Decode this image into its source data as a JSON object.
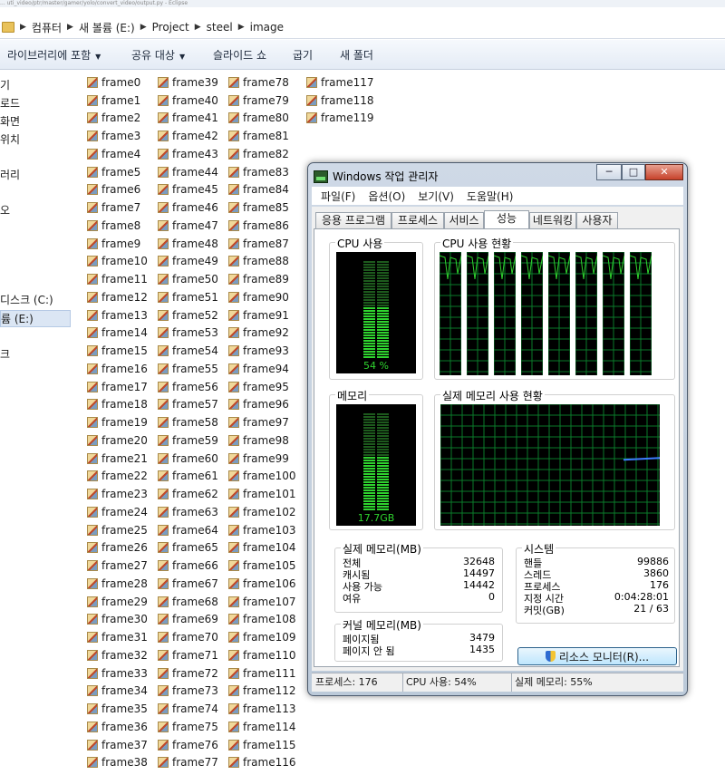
{
  "window_title_strip": "... uti_video/ptr/master/gamer/yolo/convert_video/output.py - Eclipse",
  "address_bar": {
    "segments": [
      "컴퓨터",
      "새 볼륨 (E:)",
      "Project",
      "steel",
      "image"
    ]
  },
  "toolbar": {
    "items": [
      "라이브러리에 포함",
      "공유 대상",
      "슬라이드 쇼",
      "굽기",
      "새 폴더"
    ]
  },
  "nav_pane": {
    "items": [
      "기",
      "로드",
      "화면",
      "위치",
      "러리",
      "오",
      "디스크 (C:)",
      "륨 (E:)",
      "크"
    ],
    "selected_index": 7
  },
  "files": {
    "column1": [
      "frame0",
      "frame1",
      "frame2",
      "frame3",
      "frame4",
      "frame5",
      "frame6",
      "frame7",
      "frame8",
      "frame9",
      "frame10",
      "frame11",
      "frame12",
      "frame13",
      "frame14",
      "frame15",
      "frame16",
      "frame17",
      "frame18",
      "frame19",
      "frame20",
      "frame21",
      "frame22",
      "frame23",
      "frame24",
      "frame25",
      "frame26",
      "frame27",
      "frame28",
      "frame29",
      "frame30",
      "frame31",
      "frame32",
      "frame33",
      "frame34",
      "frame35",
      "frame36",
      "frame37",
      "frame38"
    ],
    "column2": [
      "frame39",
      "frame40",
      "frame41",
      "frame42",
      "frame43",
      "frame44",
      "frame45",
      "frame46",
      "frame47",
      "frame48",
      "frame49",
      "frame50",
      "frame51",
      "frame52",
      "frame53",
      "frame54",
      "frame55",
      "frame56",
      "frame57",
      "frame58",
      "frame59",
      "frame60",
      "frame61",
      "frame62",
      "frame63",
      "frame64",
      "frame65",
      "frame66",
      "frame67",
      "frame68",
      "frame69",
      "frame70",
      "frame71",
      "frame72",
      "frame73",
      "frame74",
      "frame75",
      "frame76",
      "frame77"
    ],
    "column3": [
      "frame78",
      "frame79",
      "frame80",
      "frame81",
      "frame82",
      "frame83",
      "frame84",
      "frame85",
      "frame86",
      "frame87",
      "frame88",
      "frame89",
      "frame90",
      "frame91",
      "frame92",
      "frame93",
      "frame94",
      "frame95",
      "frame96",
      "frame97",
      "frame98",
      "frame99",
      "frame100",
      "frame101",
      "frame102",
      "frame103",
      "frame104",
      "frame105",
      "frame106",
      "frame107",
      "frame108",
      "frame109",
      "frame110",
      "frame111",
      "frame112",
      "frame113",
      "frame114",
      "frame115",
      "frame116"
    ],
    "column4": [
      "frame117",
      "frame118",
      "frame119"
    ]
  },
  "task_manager": {
    "title": "Windows 작업 관리자",
    "window_buttons": {
      "minimize": "─",
      "maximize": "□",
      "close": "✕"
    },
    "menu": [
      "파일(F)",
      "옵션(O)",
      "보기(V)",
      "도움말(H)"
    ],
    "tabs": [
      "응용 프로그램",
      "프로세스",
      "서비스",
      "성능",
      "네트워킹",
      "사용자"
    ],
    "active_tab_index": 3,
    "cpu_usage": {
      "label": "CPU 사용",
      "value_text": "54 %",
      "fraction": 0.54
    },
    "cpu_history": {
      "label": "CPU 사용 현황",
      "core_count": 8
    },
    "memory": {
      "label": "메모리",
      "value_text": "17.7GB",
      "fraction": 0.55
    },
    "memory_history": {
      "label": "실제 메모리 사용 현황"
    },
    "physical_memory": {
      "label": "실제 메모리(MB)",
      "rows": [
        {
          "k": "전체",
          "v": "32648"
        },
        {
          "k": "캐시됨",
          "v": "14497"
        },
        {
          "k": "사용 가능",
          "v": "14442"
        },
        {
          "k": "여유",
          "v": "0"
        }
      ]
    },
    "system": {
      "label": "시스템",
      "rows": [
        {
          "k": "핸들",
          "v": "99886"
        },
        {
          "k": "스레드",
          "v": "3860"
        },
        {
          "k": "프로세스",
          "v": "176"
        },
        {
          "k": "지정 시간",
          "v": "0:04:28:01"
        },
        {
          "k": "커밋(GB)",
          "v": "21 / 63"
        }
      ]
    },
    "kernel_memory": {
      "label": "커널 메모리(MB)",
      "rows": [
        {
          "k": "페이지됨",
          "v": "3479"
        },
        {
          "k": "페이지 안 됨",
          "v": "1435"
        }
      ]
    },
    "resource_monitor_button": "리소스 모니터(R)...",
    "status": {
      "processes": "프로세스: 176",
      "cpu": "CPU 사용: 54%",
      "memory": "실제 메모리: 55%"
    },
    "colors": {
      "graph_green": "#2fd42f",
      "grid": "#0a7a2a",
      "memory_line": "#3c7cff"
    }
  }
}
